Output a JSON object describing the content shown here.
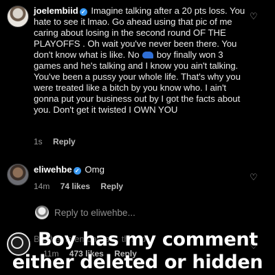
{
  "comment1": {
    "username": "joelembiid",
    "verified": true,
    "text_before_hat": "Imagine talking after a 20 pts loss. You hate to see it lmao. Go ahead using that pic of me caring about losing in the second round OF THE PLAYOFFS . Oh wait you've never been there. You don't know what is like. No ",
    "hat_icon": "blue-cap-emoji",
    "text_after_hat": " boy finally won 3 games and he's talking and I know you ain't talking. You've been a pussy your whole life. That's why you were treated like a bitch by you know who. I ain't gonna put your business out by I got the facts about you. Don't get it twisted I OWN YOU",
    "time": "1s",
    "reply_label": "Reply"
  },
  "comment2": {
    "username": "eliwehbe",
    "verified": true,
    "text": "Omg",
    "time": "14m",
    "likes": "74 likes",
    "reply_label": "Reply"
  },
  "reply_input": {
    "placeholder": "Reply to eliwehbe..."
  },
  "comment3": {
    "text": "Brother is embaras ... th s to",
    "time": "11m",
    "likes": "473 likes",
    "reply_label": "Reply"
  },
  "caption": {
    "line1": "Boy has my comment",
    "line2": "either deleted or hidden"
  },
  "colors": {
    "background": "#000000",
    "verified": "#3897f0",
    "text": "#eaeaea",
    "meta": "#9a9a9a"
  }
}
